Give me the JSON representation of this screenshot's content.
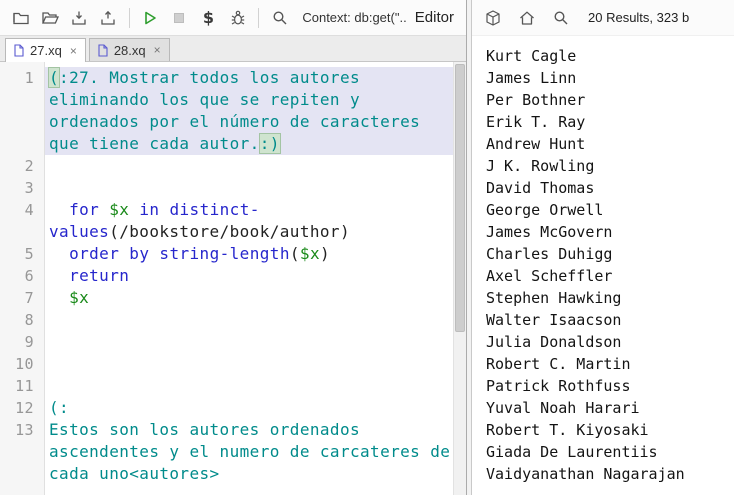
{
  "colors": {
    "comment": "#008b8b",
    "keyword": "#2626cc",
    "function": "#2626cc",
    "variable": "#1a8a1a",
    "plain": "#222222",
    "selection": "#e4e4f3",
    "run-green": "#2e9e2e",
    "line-number": "#979797"
  },
  "toolbar": {
    "context_label": "Context: db:get(\"...",
    "editor_label": "Editor",
    "dollar_icon_label": "$",
    "icons": [
      "new-file",
      "open-file",
      "save",
      "export",
      "run",
      "stop",
      "external-variables",
      "debug",
      "search"
    ]
  },
  "tabs": [
    {
      "label": "27.xq"
    },
    {
      "label": "28.xq"
    }
  ],
  "editor": {
    "lines": [
      {
        "num": 1,
        "selected": true,
        "segments": [
          {
            "t": "(",
            "c": "comment bracket"
          },
          {
            "t": ":27. Mostrar todos los autores eliminando los que se repiten y ordenados por el número de caracteres que tiene cada autor.",
            "c": "comment"
          },
          {
            "t": ":)",
            "c": "comment bracket"
          }
        ]
      },
      {
        "num": 2,
        "segments": []
      },
      {
        "num": 3,
        "segments": []
      },
      {
        "num": 4,
        "segments": [
          {
            "t": "  ",
            "c": "plain"
          },
          {
            "t": "for",
            "c": "kw"
          },
          {
            "t": " ",
            "c": "plain"
          },
          {
            "t": "$x",
            "c": "var"
          },
          {
            "t": " ",
            "c": "plain"
          },
          {
            "t": "in",
            "c": "kw"
          },
          {
            "t": " ",
            "c": "plain"
          },
          {
            "t": "distinct-values",
            "c": "fn"
          },
          {
            "t": "(/bookstore/book/author)",
            "c": "plain"
          }
        ]
      },
      {
        "num": 5,
        "segments": [
          {
            "t": "  ",
            "c": "plain"
          },
          {
            "t": "order",
            "c": "kw"
          },
          {
            "t": " ",
            "c": "plain"
          },
          {
            "t": "by",
            "c": "kw"
          },
          {
            "t": " ",
            "c": "plain"
          },
          {
            "t": "string-length",
            "c": "fn"
          },
          {
            "t": "(",
            "c": "plain"
          },
          {
            "t": "$x",
            "c": "var"
          },
          {
            "t": ")",
            "c": "plain"
          }
        ]
      },
      {
        "num": 6,
        "segments": [
          {
            "t": "  ",
            "c": "plain"
          },
          {
            "t": "return",
            "c": "kw"
          }
        ]
      },
      {
        "num": 7,
        "segments": [
          {
            "t": "  ",
            "c": "plain"
          },
          {
            "t": "$x",
            "c": "var"
          }
        ]
      },
      {
        "num": 8,
        "segments": []
      },
      {
        "num": 9,
        "segments": []
      },
      {
        "num": 10,
        "segments": []
      },
      {
        "num": 11,
        "segments": []
      },
      {
        "num": 12,
        "segments": [
          {
            "t": "(:",
            "c": "comment"
          }
        ]
      },
      {
        "num": 13,
        "segments": [
          {
            "t": "Estos son los autores ordenados ascendentes y el numero de carcateres de cada uno<autores>",
            "c": "comment"
          }
        ]
      }
    ]
  },
  "results": {
    "summary": "20 Results, 323 b",
    "icons": [
      "package",
      "home",
      "search"
    ],
    "items": [
      "Kurt Cagle",
      "James Linn",
      "Per Bothner",
      "Erik T. Ray",
      "Andrew Hunt",
      "J K. Rowling",
      "David Thomas",
      "George Orwell",
      "James McGovern",
      "Charles Duhigg",
      "Axel Scheffler",
      "Stephen Hawking",
      "Walter Isaacson",
      "Julia Donaldson",
      "Robert C. Martin",
      "Patrick Rothfuss",
      "Yuval Noah Harari",
      "Robert T. Kiyosaki",
      "Giada De Laurentiis",
      "Vaidyanathan Nagarajan"
    ]
  }
}
